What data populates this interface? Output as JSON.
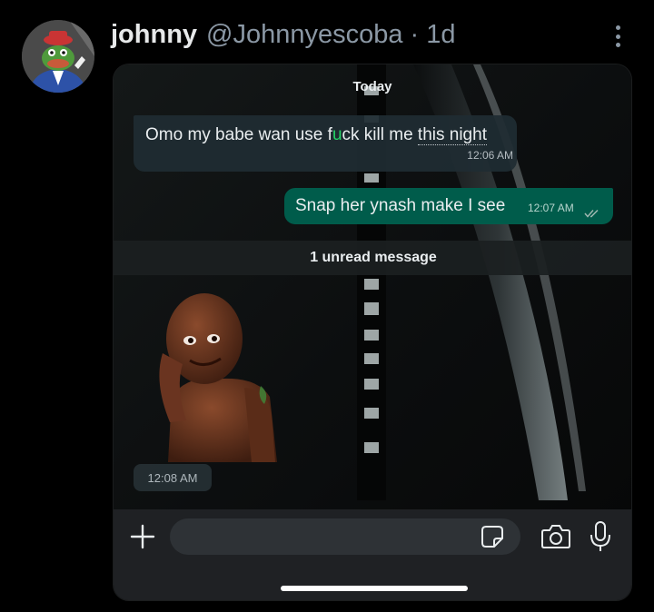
{
  "post": {
    "display_name": "johnny",
    "handle": "@Johnnyescoba",
    "separator": "·",
    "time": "1d",
    "avatar_icon": "avatar-frog-icon",
    "more_icon": "more-vertical-icon"
  },
  "chat": {
    "date_label": "Today",
    "messages": [
      {
        "direction": "incoming",
        "text_main": "Omo my babe wan use f",
        "text_cursor": "u",
        "text_rest": "ck kill me ",
        "text_underlined": "this night",
        "time": "12:06 AM"
      },
      {
        "direction": "outgoing",
        "text": "Snap her ynash make I see",
        "time": "12:07 AM",
        "status_icon": "double-check-icon"
      }
    ],
    "unread_label": "1 unread message",
    "sticker": {
      "icon": "sticker-figure-icon",
      "time": "12:08 AM"
    },
    "composer": {
      "placeholder": "",
      "value": "",
      "icons": [
        "plus-icon",
        "sticker-icon",
        "camera-icon",
        "mic-icon"
      ]
    }
  },
  "colors": {
    "background": "#000000",
    "incoming_bubble": "#1f2c33",
    "outgoing_bubble": "#005c4b",
    "composer": "#1f2124",
    "cursor_accent": "#25d366"
  }
}
